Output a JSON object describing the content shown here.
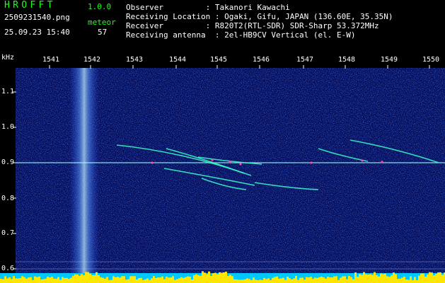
{
  "app": {
    "title": "HROFFT",
    "version": "1.0.0"
  },
  "file": {
    "name": "2509231540.png",
    "datetime": "25.09.23 15:40"
  },
  "event": {
    "type": "meteor",
    "count": "57"
  },
  "station": {
    "observer_label": "Observer",
    "observer": "Takanori Kawachi",
    "location_label": "Receiving Location",
    "location": "Ogaki, Gifu, JAPAN (136.60E, 35.35N)",
    "receiver_label": "Receiver",
    "receiver": "R820T2(RTL-SDR) SDR-Sharp 53.372MHz",
    "antenna_label": "Receiving antenna",
    "antenna": "2el-HB9CV Vertical (el. E-W)"
  },
  "axes": {
    "y_unit": "kHz",
    "y_ticks": [
      "1.1",
      "1.0",
      "0.9",
      "0.8",
      "0.7",
      "0.6"
    ],
    "x_ticks": [
      "1541",
      "1542",
      "1543",
      "1544",
      "1545",
      "1546",
      "1547",
      "1548",
      "1549",
      "1550"
    ]
  },
  "colors": {
    "header_text": "#1aff1a",
    "info_text": "#ffffff",
    "background": "#000000",
    "noise": "#0a1e9a",
    "echo": "#30ffff",
    "level": "#ffe600"
  }
}
